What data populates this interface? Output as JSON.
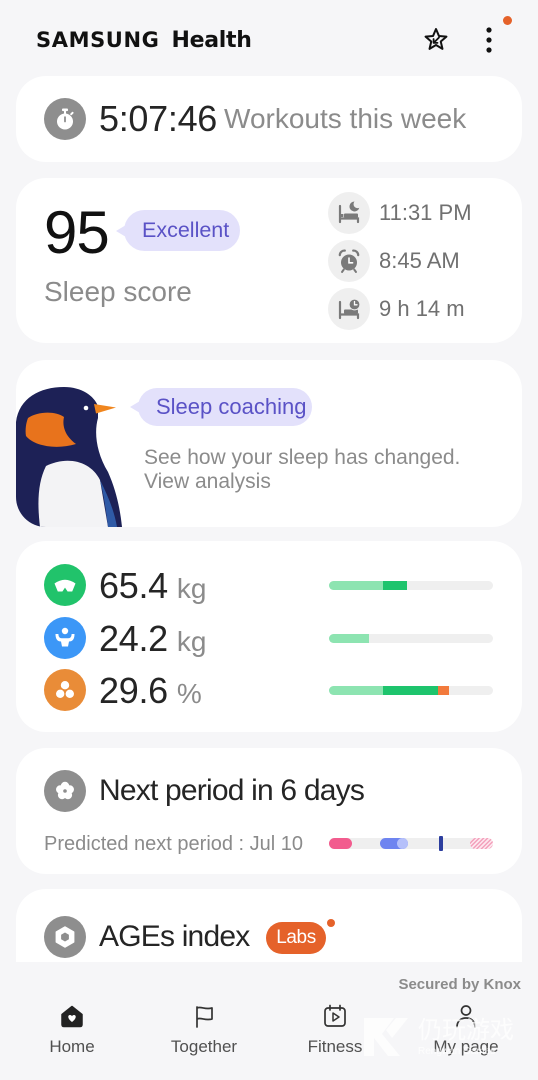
{
  "header": {
    "brand": "SAMSUNG",
    "app_name": "Health",
    "favorites_icon": "star-arrow-icon",
    "more_icon": "more-vertical-icon",
    "notification_dot_color": "#e5622a"
  },
  "workouts": {
    "icon": "stopwatch-icon",
    "time": "5:07:46",
    "label": "Workouts this week"
  },
  "sleep": {
    "score": "95",
    "rating": "Excellent",
    "label": "Sleep score",
    "details": [
      {
        "icon": "bedtime-icon",
        "value": "11:31 PM"
      },
      {
        "icon": "alarm-clock-icon",
        "value": "8:45 AM"
      },
      {
        "icon": "sleep-duration-icon",
        "value": "9 h 14 m"
      }
    ]
  },
  "coaching": {
    "illustration": "penguin",
    "badge": "Sleep coaching",
    "lines": [
      "See how your sleep has changed.",
      "View analysis"
    ]
  },
  "body_composition": {
    "rows": [
      {
        "icon": "weight-scale-icon",
        "icon_color": "#21c36b",
        "value": "65.4",
        "unit": "kg",
        "bar_fill": [
          {
            "fraction": 0.33,
            "color": "#8de4b1"
          },
          {
            "fraction": 0.146,
            "color": "#1ec46d"
          }
        ]
      },
      {
        "icon": "muscle-icon",
        "icon_color": "#3c97f7",
        "value": "24.2",
        "unit": "kg",
        "bar_fill": [
          {
            "fraction": 0.244,
            "color": "#8de4b1"
          }
        ]
      },
      {
        "icon": "body-fat-icon",
        "icon_color": "#e98c38",
        "value": "29.6",
        "unit": "%",
        "bar_fill": [
          {
            "fraction": 0.33,
            "color": "#8de4b1"
          },
          {
            "fraction": 0.335,
            "color": "#1ec46d"
          },
          {
            "fraction": 0.067,
            "color": "#f27a3c"
          }
        ]
      }
    ]
  },
  "period": {
    "icon": "flower-icon",
    "title": "Next period in 6 days",
    "subtitle": "Predicted next period : Jul 10",
    "timeline": [
      {
        "type": "period",
        "start": 0.0,
        "end": 0.14,
        "color": "#f25c8e"
      },
      {
        "type": "fertile-window",
        "start": 0.31,
        "end": 0.48,
        "color": "#6e84f0",
        "end_dot_color": "#b5c0fa"
      },
      {
        "type": "current-day",
        "start": 0.67,
        "end": 0.695,
        "color": "#2c3e9e"
      },
      {
        "type": "predicted-period",
        "start": 0.86,
        "end": 1.0,
        "color": "#f25c8e",
        "hatched": true
      }
    ]
  },
  "ages": {
    "icon": "hexagon-icon",
    "title": "AGEs index",
    "badge": "Labs",
    "badge_color": "#e5622a"
  },
  "footer": {
    "secured_by": "Secured by Knox"
  },
  "nav": [
    {
      "label": "Home",
      "icon": "home-icon",
      "active": true
    },
    {
      "label": "Together",
      "icon": "flag-icon",
      "active": false
    },
    {
      "label": "Fitness",
      "icon": "fitness-calendar-icon",
      "active": false
    },
    {
      "label": "My page",
      "icon": "person-icon",
      "active": false
    }
  ],
  "watermark": {
    "logo_text": "仍玩游戏",
    "sub_text": "Rengwan Games"
  }
}
